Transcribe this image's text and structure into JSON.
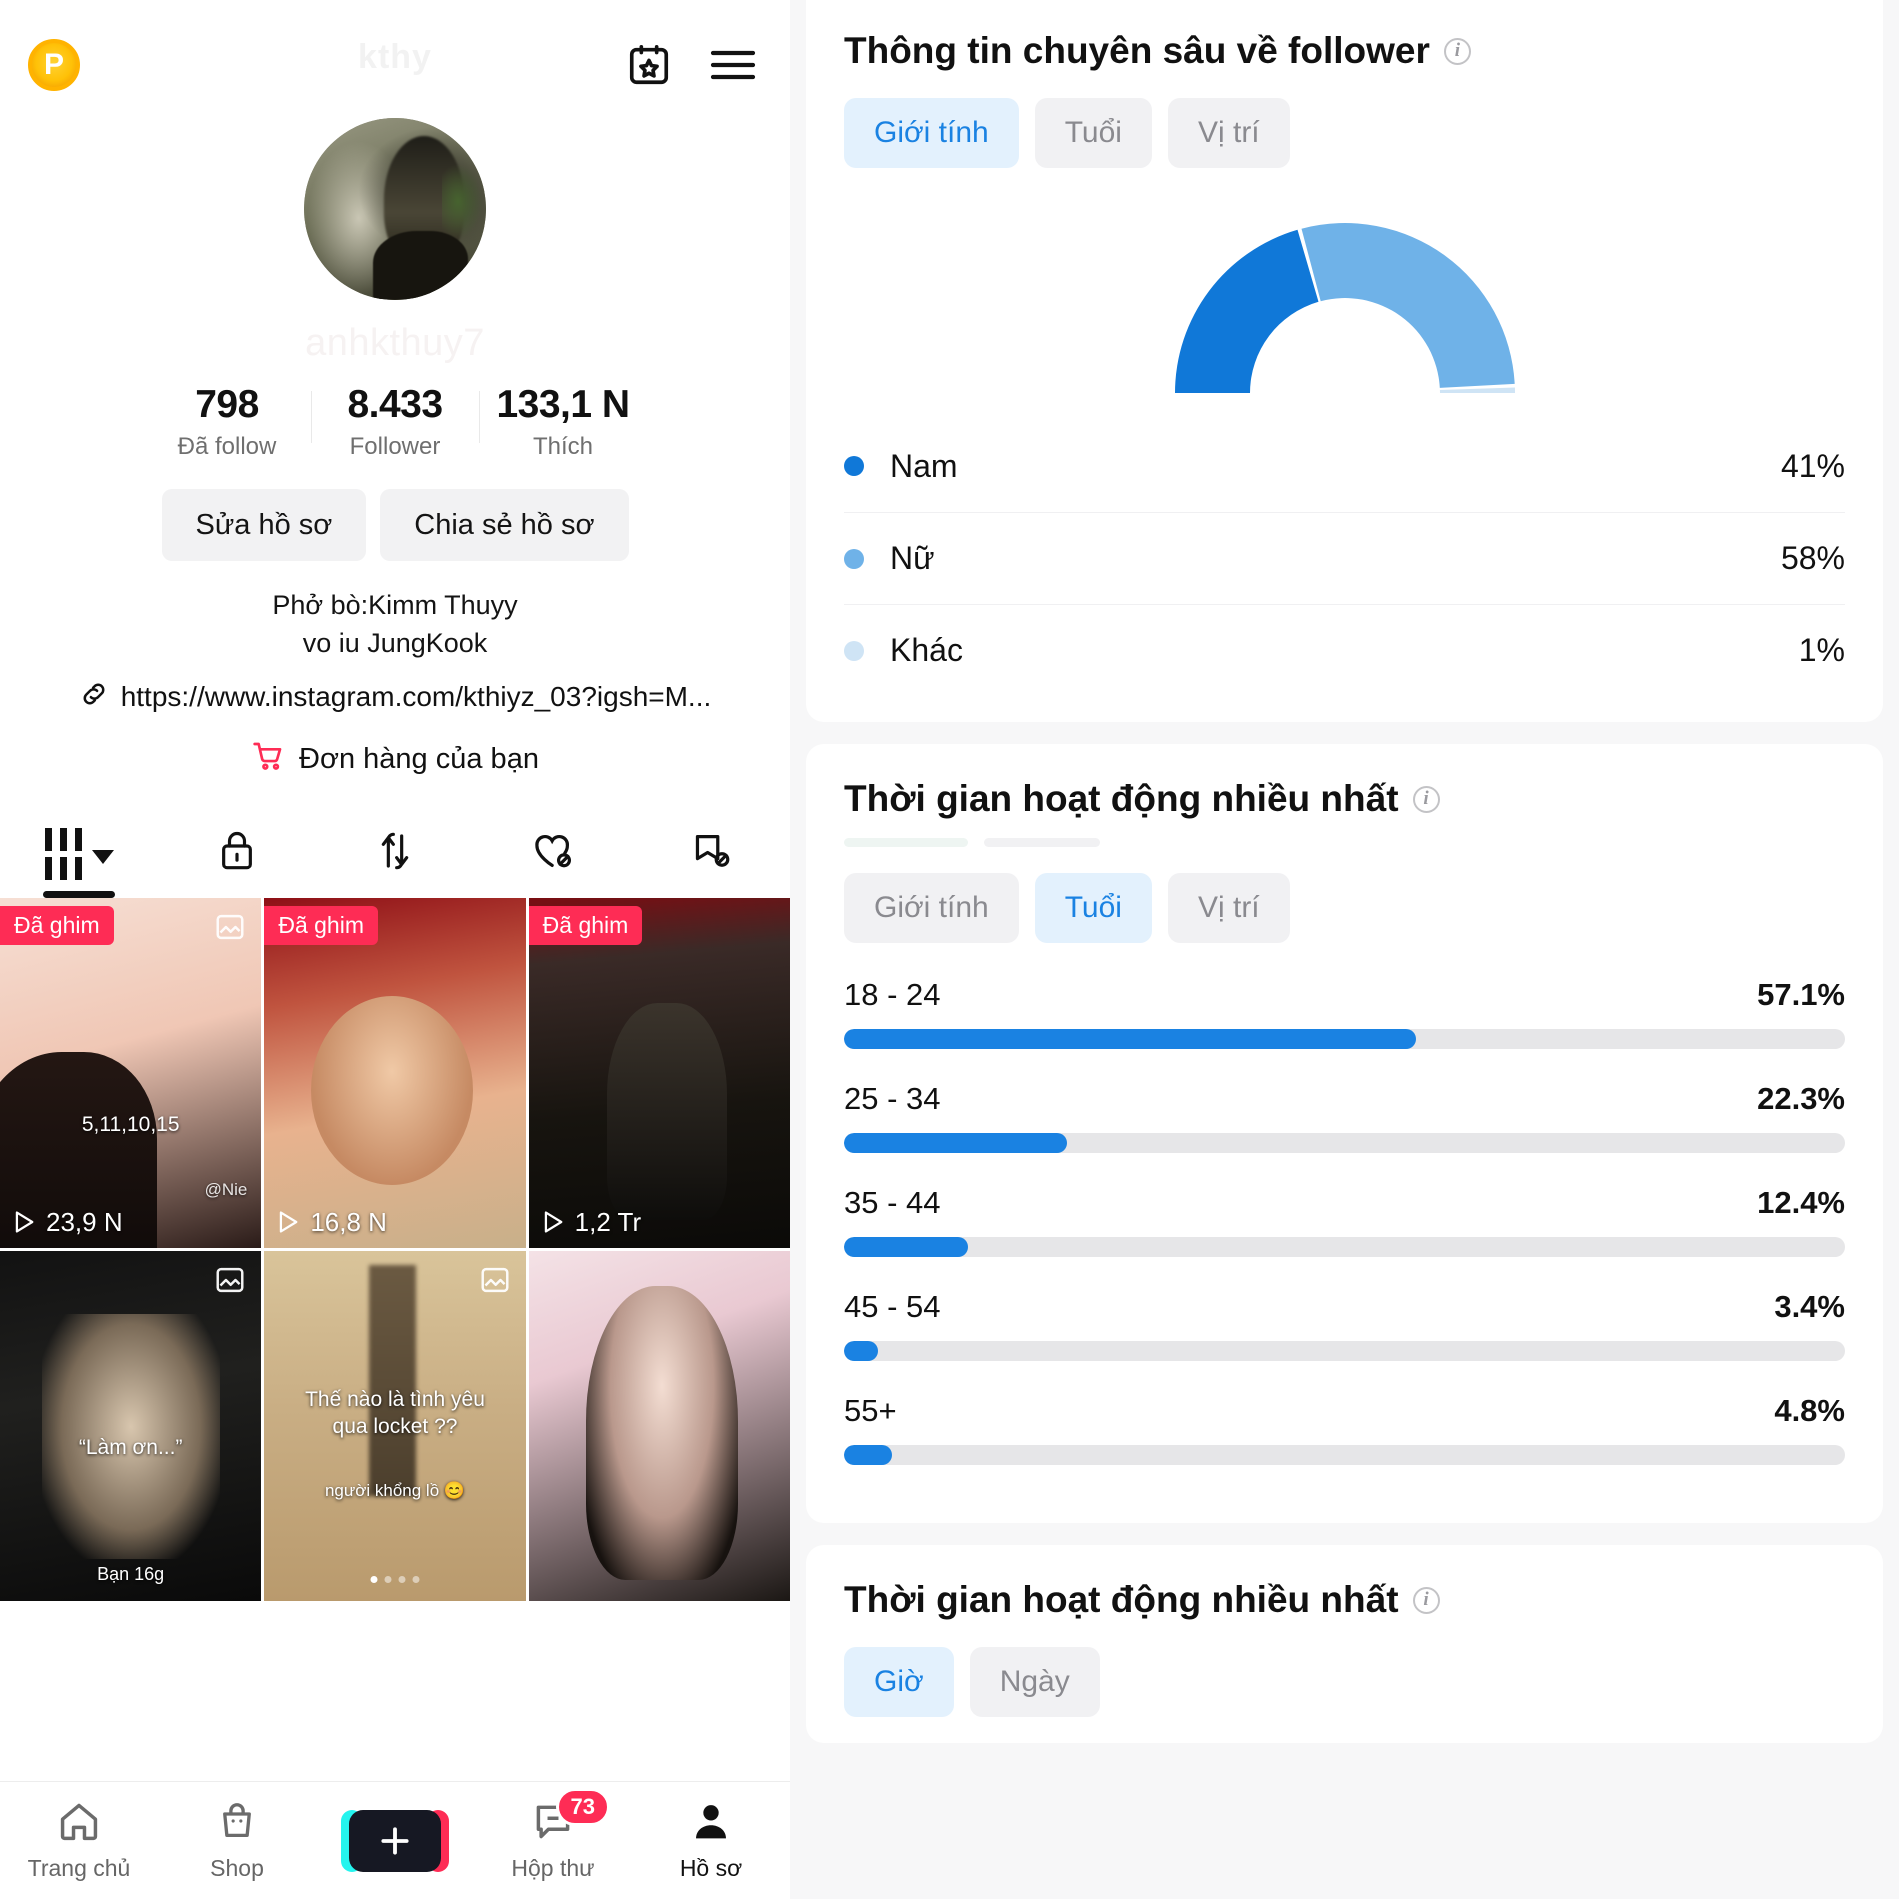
{
  "left": {
    "coin_badge": "P",
    "handle_ghost": "kthy",
    "username_ghost": "anhkthuy7",
    "stats": [
      {
        "value": "798",
        "label": "Đã follow"
      },
      {
        "value": "8.433",
        "label": "Follower"
      },
      {
        "value": "133,1 N",
        "label": "Thích"
      }
    ],
    "actions": [
      {
        "label": "Sửa hồ sơ"
      },
      {
        "label": "Chia sẻ hồ sơ"
      }
    ],
    "bio": [
      "Phở bò:Kimm Thuyy",
      "vo iu JungKook"
    ],
    "link": "https://www.instagram.com/kthiyz_03?igsh=M...",
    "order_link": "Đơn hàng của bạn",
    "profile_tabs": [
      {
        "icon": "grid-icon",
        "active": true
      },
      {
        "icon": "lock-icon",
        "active": false
      },
      {
        "icon": "repost-icon",
        "active": false
      },
      {
        "icon": "heart-hidden-icon",
        "active": false
      },
      {
        "icon": "bookmark-hidden-icon",
        "active": false
      }
    ],
    "videos": [
      {
        "pin": "Đã ghim",
        "plays": "23,9 N",
        "multi": true,
        "caption": "5,11,10,15",
        "watermark": "@Nie"
      },
      {
        "pin": "Đã ghim",
        "plays": "16,8 N",
        "multi": false,
        "caption": ""
      },
      {
        "pin": "Đã ghim",
        "plays": "1,2 Tr",
        "multi": false,
        "caption": ""
      },
      {
        "pin": "",
        "plays": "",
        "multi": true,
        "caption": "“Làm ơn...”",
        "footer": "Bạn  16g"
      },
      {
        "pin": "",
        "plays": "",
        "multi": true,
        "caption": "Thế nào là tình yêu qua locket ??",
        "sub": "người khổng lồ 😊"
      },
      {
        "pin": "",
        "plays": "",
        "multi": false,
        "caption": ""
      }
    ],
    "bottom_nav": [
      {
        "label": "Trang chủ",
        "icon": "home-icon",
        "active": false,
        "badge": ""
      },
      {
        "label": "Shop",
        "icon": "shop-icon",
        "active": false,
        "badge": ""
      },
      {
        "label": "",
        "icon": "plus-icon",
        "active": false,
        "badge": ""
      },
      {
        "label": "Hộp thư",
        "icon": "inbox-icon",
        "active": false,
        "badge": "73"
      },
      {
        "label": "Hồ sơ",
        "icon": "profile-icon",
        "active": true,
        "badge": ""
      }
    ]
  },
  "right": {
    "cards": [
      {
        "title": "Thông tin chuyên sâu về follower",
        "tabs": [
          {
            "label": "Giới tính",
            "active": true
          },
          {
            "label": "Tuổi",
            "active": false
          },
          {
            "label": "Vị trí",
            "active": false
          }
        ]
      },
      {
        "title": "Thời gian hoạt động nhiều nhất",
        "tabs": [
          {
            "label": "Giới tính",
            "active": false
          },
          {
            "label": "Tuổi",
            "active": true
          },
          {
            "label": "Vị trí",
            "active": false
          }
        ]
      },
      {
        "title": "Thời gian hoạt động nhiều nhất",
        "tabs": [
          {
            "label": "Giờ",
            "active": true
          },
          {
            "label": "Ngày",
            "active": false
          }
        ]
      }
    ],
    "colors": {
      "accent": "#1a82e2",
      "accent_light": "#6fb2e8",
      "accent_pale": "#cfe4f5",
      "track": "#e6e6e8",
      "tab_on_bg": "#e3f1fd"
    }
  },
  "chart_data": [
    {
      "type": "pie",
      "title": "Thông tin chuyên sâu về follower",
      "subtitle": "Giới tính",
      "style": "half-donut-gauge",
      "legend_position": "below",
      "categories": [
        "Nam",
        "Nữ",
        "Khác"
      ],
      "values": [
        41,
        58,
        1
      ],
      "value_labels": [
        "41%",
        "58%",
        "1%"
      ],
      "colors": [
        "#1a82e2",
        "#6fb2e8",
        "#cfe4f5"
      ]
    },
    {
      "type": "bar",
      "orientation": "horizontal",
      "title": "Thời gian hoạt động nhiều nhất",
      "subtitle": "Tuổi",
      "xlabel": "",
      "ylabel": "",
      "xlim": [
        0,
        100
      ],
      "grid": false,
      "categories": [
        "18 - 24",
        "25 - 34",
        "35 - 44",
        "45 - 54",
        "55+"
      ],
      "values": [
        57.1,
        22.3,
        12.4,
        3.4,
        4.8
      ],
      "value_labels": [
        "57.1%",
        "22.3%",
        "12.4%",
        "3.4%",
        "4.8%"
      ],
      "color": "#1a82e2"
    }
  ]
}
